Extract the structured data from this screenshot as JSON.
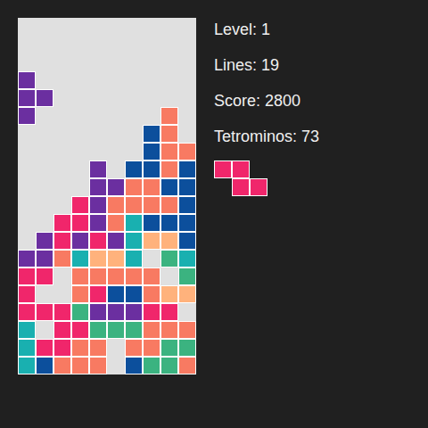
{
  "board": {
    "rows": [
      [
        "",
        "",
        "",
        "",
        "",
        "",
        "",
        "",
        "",
        ""
      ],
      [
        "",
        "",
        "",
        "",
        "",
        "",
        "",
        "",
        "",
        ""
      ],
      [
        "",
        "",
        "",
        "",
        "",
        "",
        "",
        "",
        "",
        ""
      ],
      [
        "#6b2fa0",
        "",
        "",
        "",
        "",
        "",
        "",
        "",
        "",
        ""
      ],
      [
        "#6b2fa0",
        "#6b2fa0",
        "",
        "",
        "",
        "",
        "",
        "",
        "",
        ""
      ],
      [
        "#6b2fa0",
        "",
        "",
        "",
        "",
        "",
        "",
        "",
        "#f87a62",
        ""
      ],
      [
        "",
        "",
        "",
        "",
        "",
        "",
        "",
        "#0c4f9c",
        "#f87a62",
        ""
      ],
      [
        "",
        "",
        "",
        "",
        "",
        "",
        "",
        "#0c4f9c",
        "#f87a62",
        "#f87a62"
      ],
      [
        "",
        "",
        "",
        "",
        "#6b2fa0",
        "",
        "#0c4f9c",
        "#0c4f9c",
        "#f87a62",
        "#0c4f9c"
      ],
      [
        "",
        "",
        "",
        "",
        "#6b2fa0",
        "#6b2fa0",
        "#f87a62",
        "#f87a62",
        "#0c4f9c",
        "#0c4f9c"
      ],
      [
        "",
        "",
        "",
        "#f0266b",
        "#6b2fa0",
        "#f87a62",
        "#f87a62",
        "#f87a62",
        "#f87a62",
        "#0c4f9c"
      ],
      [
        "",
        "",
        "#f0266b",
        "#f0266b",
        "#6b2fa0",
        "#f87a62",
        "#19b0b0",
        "#0c4f9c",
        "#0c4f9c",
        "#0c4f9c"
      ],
      [
        "",
        "#6b2fa0",
        "#f0266b",
        "#6b2fa0",
        "#f0266b",
        "#6b2fa0",
        "#19b0b0",
        "#ffb27c",
        "#ffb27c",
        "#0c4f9c"
      ],
      [
        "#6b2fa0",
        "#6b2fa0",
        "#f87a62",
        "#19b0b0",
        "#ffb27c",
        "#ffb27c",
        "#19b0b0",
        "",
        "#3bb380",
        "#19b0b0"
      ],
      [
        "#f0266b",
        "#f0266b",
        "",
        "#f87a62",
        "#f87a62",
        "#f87a62",
        "#f87a62",
        "#f87a62",
        "",
        "#3bb380"
      ],
      [
        "#f0266b",
        "",
        "",
        "#f87a62",
        "#f0266b",
        "#0c4f9c",
        "#0c4f9c",
        "#f87a62",
        "#ffb27c",
        "#ffb27c"
      ],
      [
        "#f0266b",
        "#f0266b",
        "#f0266b",
        "#3bb380",
        "#6b2fa0",
        "#6b2fa0",
        "#6b2fa0",
        "#f0266b",
        "#f0266b",
        ""
      ],
      [
        "#19b0b0",
        "",
        "#f0266b",
        "#f0266b",
        "#3bb380",
        "#3bb380",
        "#3bb380",
        "#f87a62",
        "#f87a62",
        "#f87a62"
      ],
      [
        "#19b0b0",
        "#f0266b",
        "#f0266b",
        "#f87a62",
        "#f87a62",
        "",
        "#f87a62",
        "#f87a62",
        "#3bb380",
        "#3bb380"
      ],
      [
        "#19b0b0",
        "#0c4f9c",
        "#f87a62",
        "#f87a62",
        "#f87a62",
        "",
        "#0c4f9c",
        "#3bb380",
        "#3bb380",
        "#f87a62"
      ]
    ]
  },
  "stats": [
    "Level: 1",
    "Lines: 19",
    "Score: 2800",
    "Tetrominos: 73"
  ],
  "next_piece": {
    "color": "#f0266b",
    "shape": [
      [
        1,
        1,
        0
      ],
      [
        0,
        1,
        1
      ]
    ]
  }
}
